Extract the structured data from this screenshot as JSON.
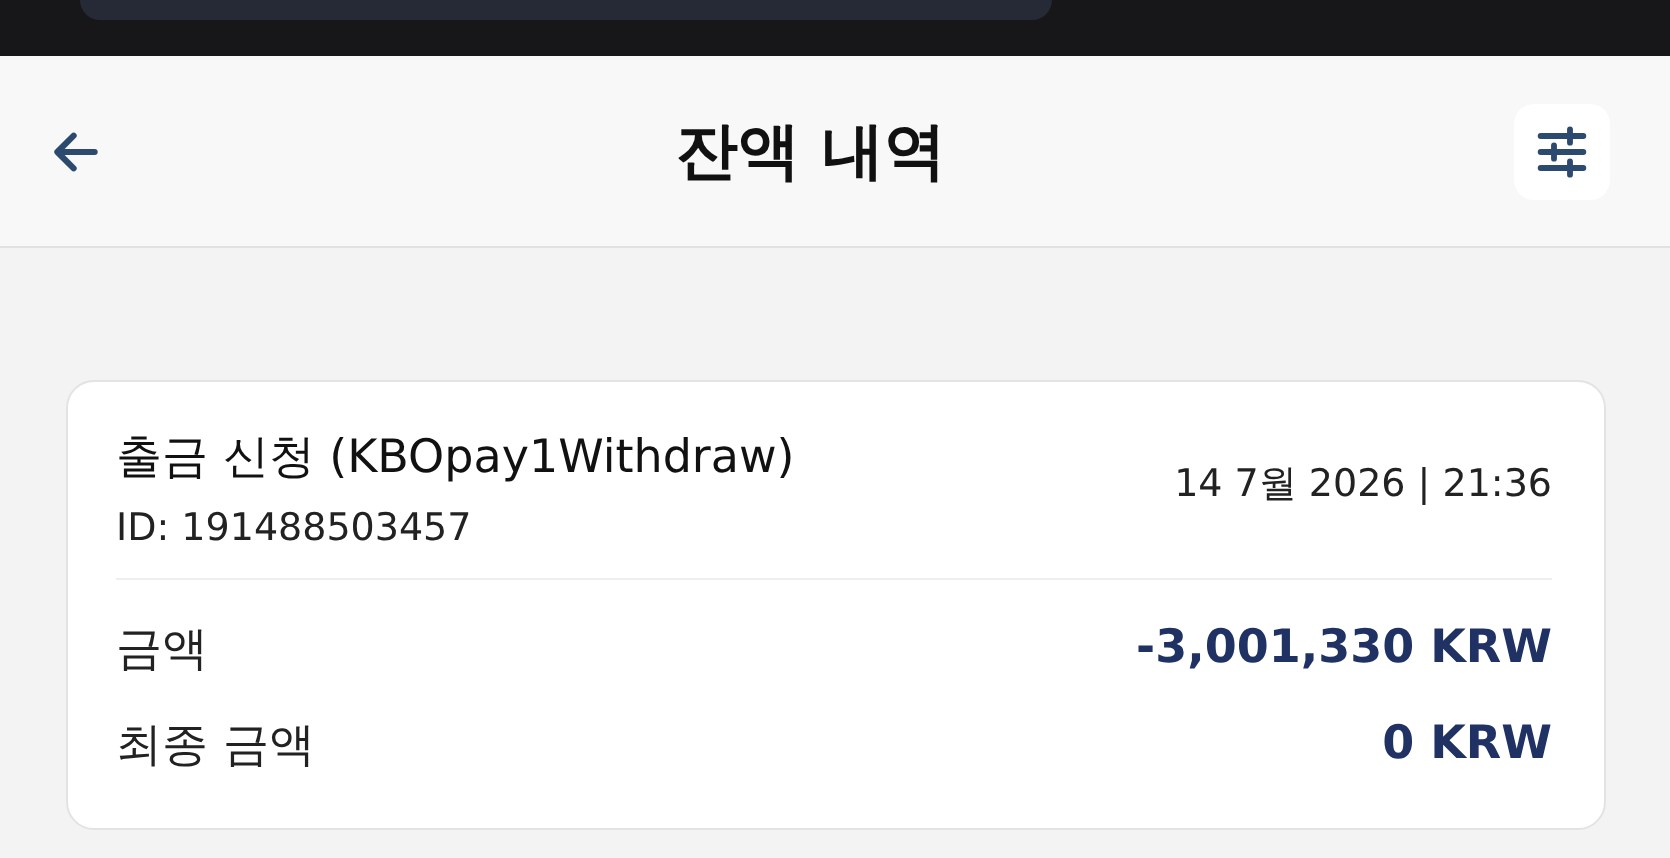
{
  "header": {
    "title": "잔액 내역"
  },
  "transaction": {
    "title": "출금 신청 (KBOpay1Withdraw)",
    "id": "ID: 191488503457",
    "datetime": "14 7월 2026 | 21:36",
    "rows": [
      {
        "label": "금액",
        "value": "-3,001,330 KRW"
      },
      {
        "label": "최종 금액",
        "value": "0 KRW"
      }
    ]
  }
}
